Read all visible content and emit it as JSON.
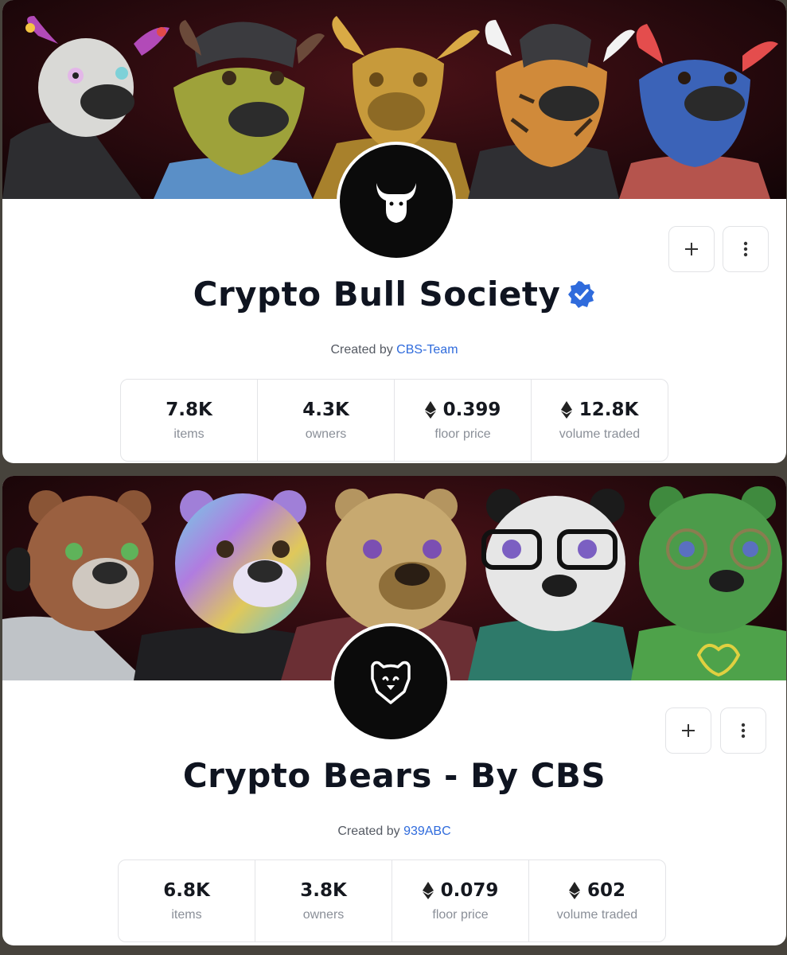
{
  "collections": [
    {
      "name": "Crypto Bull Society",
      "verified": true,
      "created_by_label": "Created by",
      "creator": "CBS-Team",
      "stats": [
        {
          "value": "7.8K",
          "label": "items",
          "eth": false
        },
        {
          "value": "4.3K",
          "label": "owners",
          "eth": false
        },
        {
          "value": "0.399",
          "label": "floor price",
          "eth": true
        },
        {
          "value": "12.8K",
          "label": "volume traded",
          "eth": true
        }
      ],
      "logo_icon": "bull-head-icon",
      "banner_subject": "bull-characters"
    },
    {
      "name": "Crypto Bears - By CBS",
      "verified": false,
      "created_by_label": "Created by",
      "creator": "939ABC",
      "stats": [
        {
          "value": "6.8K",
          "label": "items",
          "eth": false
        },
        {
          "value": "3.8K",
          "label": "owners",
          "eth": false
        },
        {
          "value": "0.079",
          "label": "floor price",
          "eth": true
        },
        {
          "value": "602",
          "label": "volume traded",
          "eth": true
        }
      ],
      "logo_icon": "bear-head-icon",
      "banner_subject": "bear-characters"
    }
  ],
  "colors": {
    "link": "#2f6bdc",
    "verified_badge": "#2f6bdc",
    "banner_bg": "#2a0a0e",
    "page_bg": "#47433c"
  },
  "icons": {
    "add": "plus-icon",
    "more": "vertical-dots-icon",
    "currency": "ethereum-icon"
  }
}
